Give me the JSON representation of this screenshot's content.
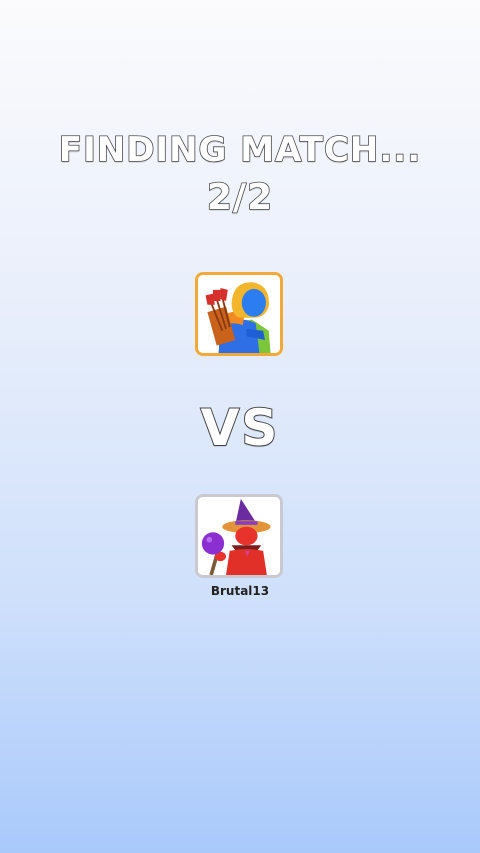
{
  "matchmaking": {
    "status_text": "FINDING MATCH...",
    "player_count": "2/2",
    "versus_label": "VS"
  },
  "player": {
    "avatar_icon": "archer-hero-icon",
    "frame_color": "#f2a93a"
  },
  "opponent": {
    "name": "Brutal13",
    "avatar_icon": "wizard-hero-icon",
    "frame_color": "#c9c9cf"
  },
  "colors": {
    "background_top": "#fbfbfd",
    "background_bottom": "#a9c9fb",
    "text_outline": "#4a4a4a",
    "text_fill": "#ffffff"
  }
}
